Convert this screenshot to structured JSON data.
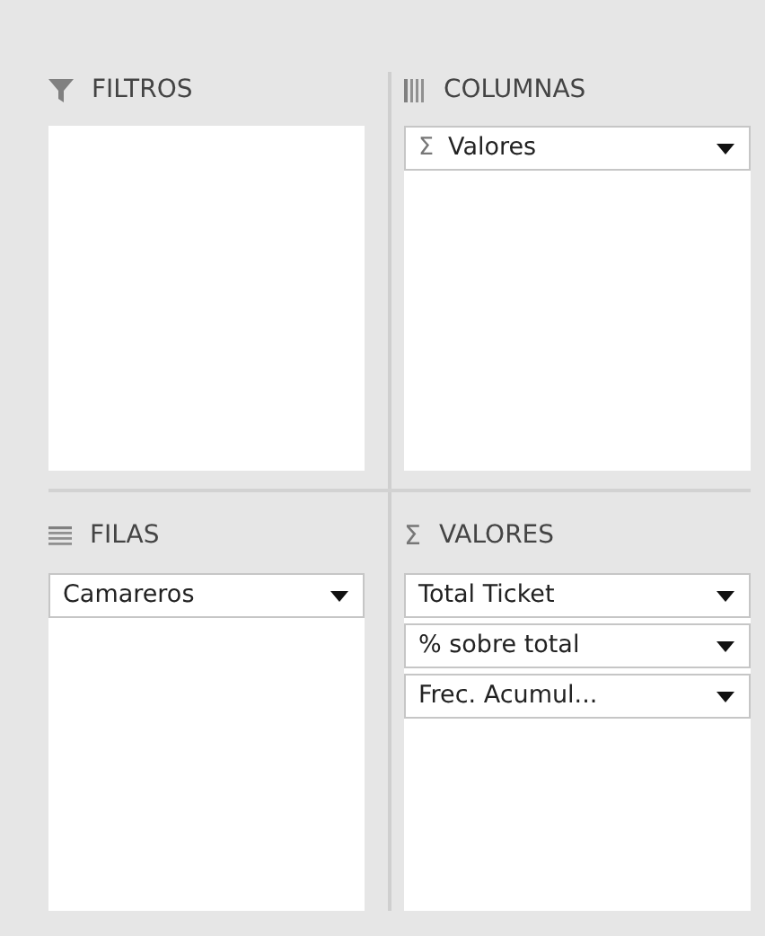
{
  "areas": [
    {
      "title": "FILTROS",
      "kind": "filter"
    },
    {
      "title": "COLUMNAS",
      "kind": "columns",
      "fields": [
        {
          "symbol": "Σ",
          "label": "Valores"
        }
      ]
    },
    {
      "title": "FILAS",
      "kind": "rows",
      "fields": [
        {
          "label": "Camareros"
        }
      ]
    },
    {
      "title": "VALORES",
      "symbol": "Σ",
      "fields": [
        {
          "label": "Total Ticket"
        },
        {
          "label": "% sobre total"
        },
        {
          "label": "Frec. Acumul..."
        }
      ]
    }
  ]
}
